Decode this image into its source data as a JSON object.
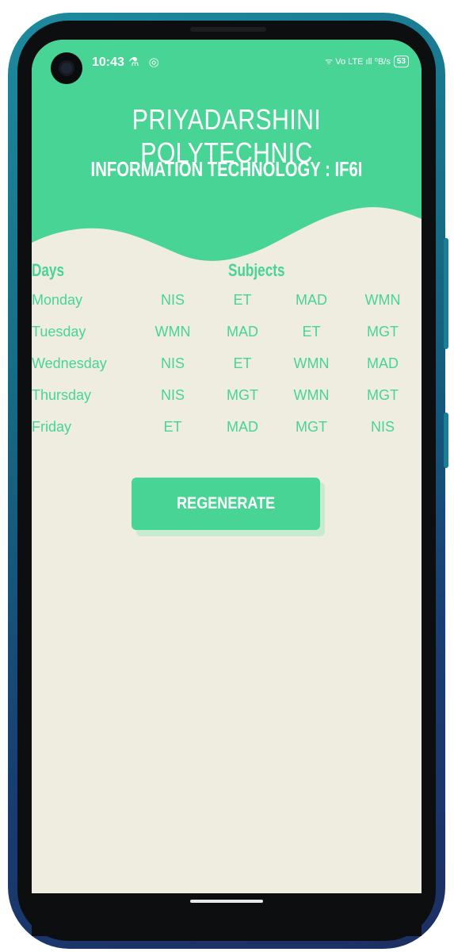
{
  "status_bar": {
    "time": "10:43",
    "left_icons": "⚗ ◎",
    "right_icons": "ᯤ Vo LTE ıll ⁰B/s",
    "battery": "53"
  },
  "header": {
    "college": "PRIYADARSHINI POLYTECHNIC",
    "department": "INFORMATION TECHNOLOGY : IF6I"
  },
  "timetable": {
    "days_header": "Days",
    "subjects_header": "Subjects",
    "rows": [
      {
        "day": "Monday",
        "subjects": [
          "NIS",
          "ET",
          "MAD",
          "WMN"
        ]
      },
      {
        "day": "Tuesday",
        "subjects": [
          "WMN",
          "MAD",
          "ET",
          "MGT"
        ]
      },
      {
        "day": "Wednesday",
        "subjects": [
          "NIS",
          "ET",
          "WMN",
          "MAD"
        ]
      },
      {
        "day": "Thursday",
        "subjects": [
          "NIS",
          "MGT",
          "WMN",
          "MGT"
        ]
      },
      {
        "day": "Friday",
        "subjects": [
          "ET",
          "MAD",
          "MGT",
          "NIS"
        ]
      }
    ]
  },
  "actions": {
    "regenerate_label": "REGENERATE"
  },
  "colors": {
    "accent": "#47d494",
    "background": "#efede0",
    "text_on_accent": "#ffffff"
  }
}
